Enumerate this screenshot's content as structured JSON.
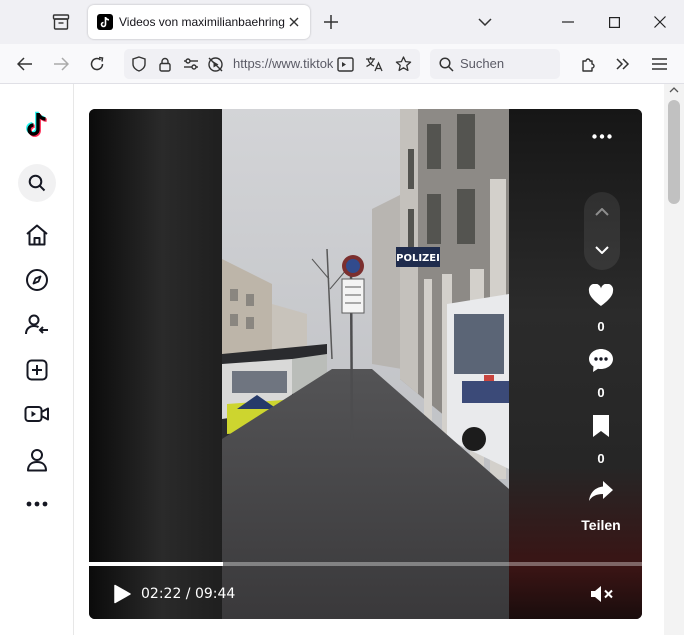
{
  "browser": {
    "tab_title": "Videos von maximilianbaehring",
    "url": "https://www.tiktok.com",
    "search_placeholder": "Suchen"
  },
  "video": {
    "time_current": "02:22",
    "time_total": "09:44",
    "time_display": "02:22 / 09:44",
    "progress": 0.243,
    "likes": "0",
    "comments": "0",
    "saves": "0",
    "share_label": "Teilen",
    "sign_text": "POLIZEI"
  },
  "colors": {
    "chrome_bg": "#f0f0f4",
    "player_bg": "#101010",
    "accent": "#fe2c55"
  }
}
